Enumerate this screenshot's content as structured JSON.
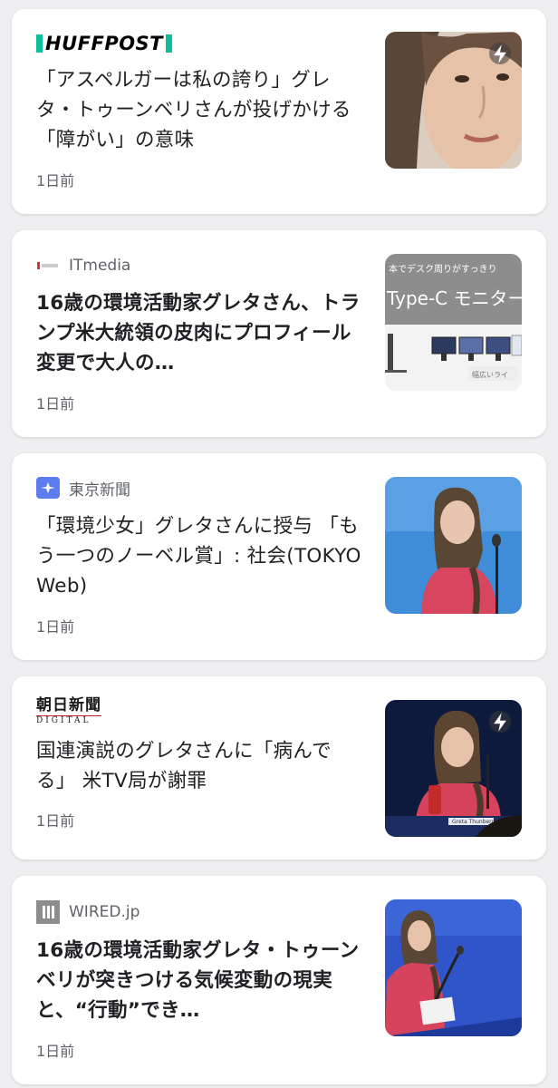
{
  "articles": [
    {
      "source": "HUFFPOST",
      "headline": "「アスペルガーは私の誇り」グレタ・トゥーンベリさんが投げかける「障がい」の意味",
      "time": "1日前",
      "amp": true,
      "thumb_icon": "portrait-photo"
    },
    {
      "source": "ITmedia",
      "headline": "16歳の環境活動家グレタさん、トランプ米大統領の皮肉にプロフィール変更で大人の…",
      "time": "1日前",
      "amp": false,
      "thumb_icon": "monitor-ad-photo",
      "thumb_text": {
        "banner": "本でデスク周りがすっきり",
        "product": "Type-C モニター",
        "caption": "幅広いライ"
      }
    },
    {
      "source": "東京新聞",
      "headline": "「環境少女」グレタさんに授与 「もう一つのノーベル賞」: 社会(TOKYO Web)",
      "time": "1日前",
      "amp": false,
      "thumb_icon": "speaker-photo"
    },
    {
      "source_jp": "朝日新聞",
      "source_en": "DIGITAL",
      "headline": "国連演説のグレタさんに「病んでる」 米TV局が謝罪",
      "time": "1日前",
      "amp": true,
      "thumb_icon": "un-speech-photo",
      "thumb_caption": "Greta Thunberg"
    },
    {
      "source": "WIRED.jp",
      "headline": "16歳の環境活動家グレタ・トゥーンベリが突きつける気候変動の現実と、“行動”でき…",
      "time": "1日前",
      "amp": false,
      "thumb_icon": "podium-photo"
    }
  ],
  "colors": {
    "background": "#efeff1",
    "card": "#ffffff",
    "meta_text": "#5f6368",
    "huffpost_green": "#0dbe98",
    "tokyo_blue": "#5b7df0",
    "asahi_red": "#c8202a"
  }
}
